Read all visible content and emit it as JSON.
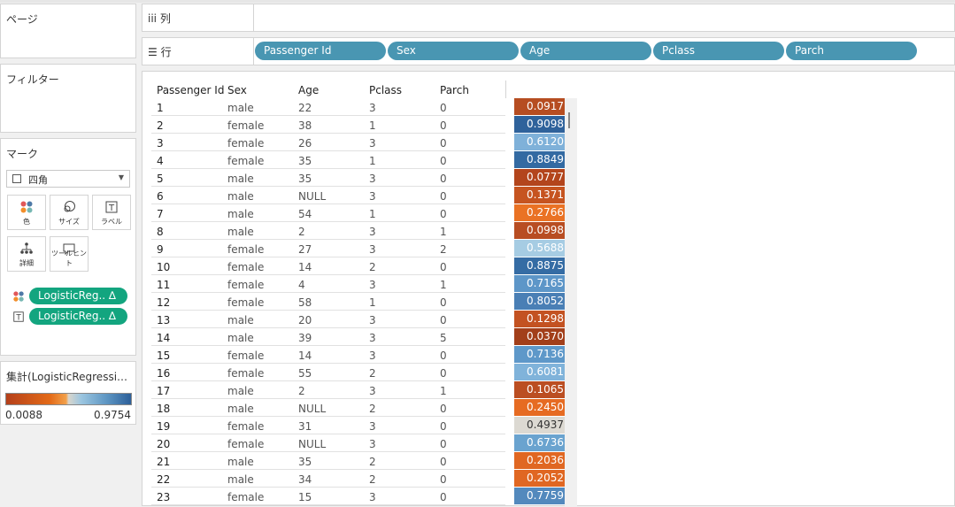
{
  "panels": {
    "pages_title": "ページ",
    "filters_title": "フィルター",
    "marks_title": "マーク",
    "mark_type": "四角",
    "buttons": [
      {
        "label": "色",
        "icon": "color-dots-icon"
      },
      {
        "label": "サイズ",
        "icon": "size-icon"
      },
      {
        "label": "ラベル",
        "icon": "label-icon"
      },
      {
        "label": "詳細",
        "icon": "detail-icon"
      },
      {
        "label": "ツールヒント",
        "icon": "tooltip-icon"
      }
    ],
    "mark_fields": [
      {
        "label": "LogisticReg.. ∆",
        "icon": "color-dots-icon"
      },
      {
        "label": "LogisticReg.. ∆",
        "icon": "label-icon"
      }
    ],
    "legend_title": "集計(LogisticRegressi…",
    "legend_min": "0.0088",
    "legend_max": "0.9754"
  },
  "shelves": {
    "columns_label": "列",
    "rows_label": "行",
    "row_pills": [
      "Passenger Id",
      "Sex",
      "Age",
      "Pclass",
      "Parch"
    ]
  },
  "table": {
    "headers": [
      "Passenger Id",
      "Sex",
      "Age",
      "Pclass",
      "Parch"
    ],
    "rows": [
      {
        "id": "1",
        "sex": "male",
        "age": "22",
        "pclass": "3",
        "parch": "0",
        "value": "0.0917",
        "color": "#b64d21"
      },
      {
        "id": "2",
        "sex": "female",
        "age": "38",
        "pclass": "1",
        "parch": "0",
        "value": "0.9098",
        "color": "#2f629b"
      },
      {
        "id": "3",
        "sex": "female",
        "age": "26",
        "pclass": "3",
        "parch": "0",
        "value": "0.6120",
        "color": "#7fb1d9"
      },
      {
        "id": "4",
        "sex": "female",
        "age": "35",
        "pclass": "1",
        "parch": "0",
        "value": "0.8849",
        "color": "#336aa2"
      },
      {
        "id": "5",
        "sex": "male",
        "age": "35",
        "pclass": "3",
        "parch": "0",
        "value": "0.0777",
        "color": "#b3451c"
      },
      {
        "id": "6",
        "sex": "male",
        "age": "NULL",
        "pclass": "3",
        "parch": "0",
        "value": "0.1371",
        "color": "#c65420"
      },
      {
        "id": "7",
        "sex": "male",
        "age": "54",
        "pclass": "1",
        "parch": "0",
        "value": "0.2766",
        "color": "#ea7224"
      },
      {
        "id": "8",
        "sex": "male",
        "age": "2",
        "pclass": "3",
        "parch": "1",
        "value": "0.0998",
        "color": "#b84d22"
      },
      {
        "id": "9",
        "sex": "female",
        "age": "27",
        "pclass": "3",
        "parch": "2",
        "value": "0.5688",
        "color": "#a6cce3"
      },
      {
        "id": "10",
        "sex": "female",
        "age": "14",
        "pclass": "2",
        "parch": "0",
        "value": "0.8875",
        "color": "#356ca4"
      },
      {
        "id": "11",
        "sex": "female",
        "age": "4",
        "pclass": "3",
        "parch": "1",
        "value": "0.7165",
        "color": "#5d96c8"
      },
      {
        "id": "12",
        "sex": "female",
        "age": "58",
        "pclass": "1",
        "parch": "0",
        "value": "0.8052",
        "color": "#4a7fb5"
      },
      {
        "id": "13",
        "sex": "male",
        "age": "20",
        "pclass": "3",
        "parch": "0",
        "value": "0.1298",
        "color": "#c35221"
      },
      {
        "id": "14",
        "sex": "male",
        "age": "39",
        "pclass": "3",
        "parch": "5",
        "value": "0.0370",
        "color": "#a23f1a"
      },
      {
        "id": "15",
        "sex": "female",
        "age": "14",
        "pclass": "3",
        "parch": "0",
        "value": "0.7136",
        "color": "#5e98c9"
      },
      {
        "id": "16",
        "sex": "female",
        "age": "55",
        "pclass": "2",
        "parch": "0",
        "value": "0.6081",
        "color": "#80b3da"
      },
      {
        "id": "17",
        "sex": "male",
        "age": "2",
        "pclass": "3",
        "parch": "1",
        "value": "0.1065",
        "color": "#bb4e22"
      },
      {
        "id": "18",
        "sex": "male",
        "age": "NULL",
        "pclass": "2",
        "parch": "0",
        "value": "0.2450",
        "color": "#e66b22"
      },
      {
        "id": "19",
        "sex": "female",
        "age": "31",
        "pclass": "3",
        "parch": "0",
        "value": "0.4937",
        "color": "#dcd9d2"
      },
      {
        "id": "20",
        "sex": "female",
        "age": "NULL",
        "pclass": "3",
        "parch": "0",
        "value": "0.6736",
        "color": "#6aa3cf"
      },
      {
        "id": "21",
        "sex": "male",
        "age": "35",
        "pclass": "2",
        "parch": "0",
        "value": "0.2036",
        "color": "#e06722"
      },
      {
        "id": "22",
        "sex": "male",
        "age": "34",
        "pclass": "2",
        "parch": "0",
        "value": "0.2052",
        "color": "#e06722"
      },
      {
        "id": "23",
        "sex": "female",
        "age": "15",
        "pclass": "3",
        "parch": "0",
        "value": "0.7759",
        "color": "#5389bd"
      }
    ]
  }
}
